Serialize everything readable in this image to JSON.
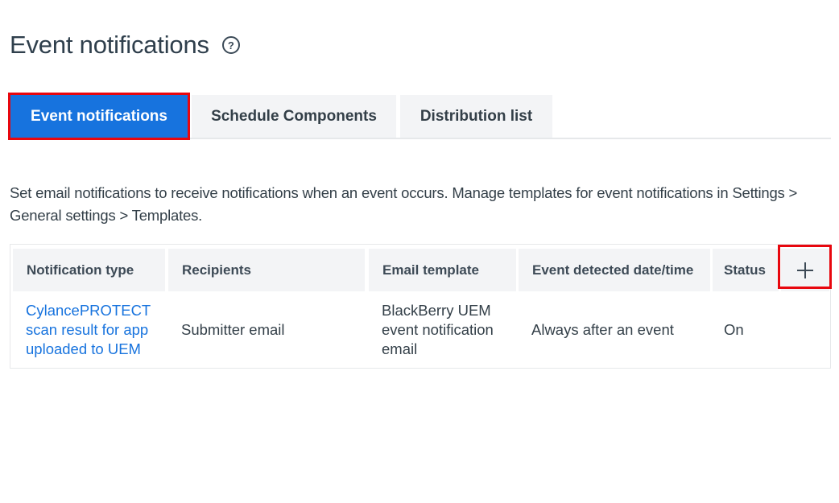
{
  "header": {
    "title": "Event notifications",
    "help_icon": "help-circle-icon",
    "help_glyph": "?"
  },
  "tabs": [
    {
      "label": "Event notifications",
      "active": true
    },
    {
      "label": "Schedule Components",
      "active": false
    },
    {
      "label": "Distribution list",
      "active": false
    }
  ],
  "description": "Set email notifications to receive notifications when an event occurs. Manage templates for event notifications in Settings > General settings > Templates.",
  "table": {
    "columns": [
      "Notification type",
      "Recipients",
      "Email template",
      "Event detected date/time",
      "Status"
    ],
    "add_icon": "plus-icon",
    "rows": [
      {
        "notification_type": "CylancePROTECT scan result for app uploaded to UEM",
        "recipients": "Submitter email",
        "email_template": "BlackBerry UEM event notification email",
        "event_detected": "Always after an event",
        "status": "On"
      }
    ]
  },
  "colors": {
    "accent": "#1773de",
    "highlight": "#e8070e",
    "header_bg": "#f3f4f6",
    "text": "#333f48"
  }
}
